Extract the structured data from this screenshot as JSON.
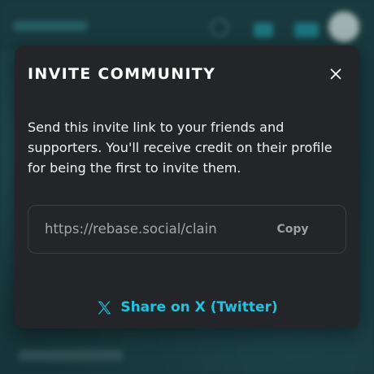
{
  "modal": {
    "title": "INVITE COMMUNITY",
    "close_label": "×",
    "description": "Send this invite link to your friends and supporters. You'll receive credit on their profile for being the first to invite them.",
    "invite_link": {
      "value": "https://rebase.social/clain",
      "copy_label": "Copy"
    },
    "share": {
      "label": "Share on X (Twitter)",
      "icon": "x-logo-icon"
    }
  },
  "colors": {
    "modal_background": "#232528",
    "accent": "#1fc3df",
    "backdrop": "#17383d"
  }
}
